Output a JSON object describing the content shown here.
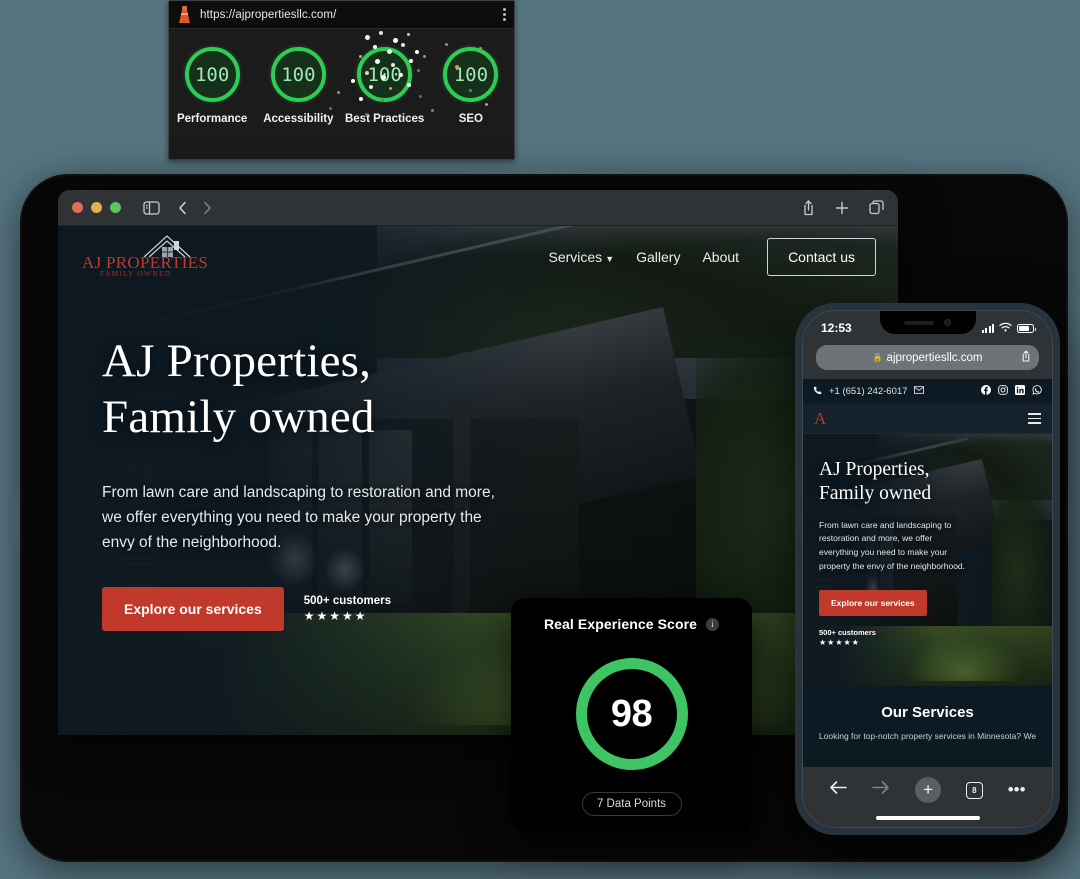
{
  "lighthouse": {
    "favicon_name": "lighthouse-icon",
    "url": "https://ajpropertiesllc.com/",
    "menu_icon": "kebab-menu-icon",
    "scores": [
      {
        "value": "100",
        "label": "Performance"
      },
      {
        "value": "100",
        "label": "Accessibility"
      },
      {
        "value": "100",
        "label": "Best Practices"
      },
      {
        "value": "100",
        "label": "SEO"
      }
    ],
    "ring_color": "#2ecc56",
    "score_text_color": "#9fe8af"
  },
  "browser": {
    "traffic_lights": [
      "close",
      "minimize",
      "zoom"
    ],
    "sidebar_icon": "sidebar-icon",
    "back_icon": "chevron-left-icon",
    "forward_icon": "chevron-right-icon",
    "share_icon": "share-icon",
    "new_tab_icon": "plus-icon",
    "tabs_icon": "tab-overview-icon"
  },
  "site": {
    "logo": {
      "line1": "AJ PROPERTIES",
      "line2": "FAMILY OWNED",
      "icon": "house-roof-icon"
    },
    "nav": [
      {
        "label": "Services",
        "has_dropdown": true
      },
      {
        "label": "Gallery",
        "has_dropdown": false
      },
      {
        "label": "About",
        "has_dropdown": false
      }
    ],
    "contact_button": "Contact us",
    "hero": {
      "title_line1": "AJ Properties,",
      "title_line2": "Family owned",
      "paragraph": "From lawn care and landscaping to restoration and more, we offer everything you need to make your property the envy of the neighborhood.",
      "cta": "Explore our services",
      "social_proof": "500+ customers",
      "stars": "★★★★★"
    },
    "accent_color": "#c0392b"
  },
  "score_card": {
    "title": "Real Experience Score",
    "info_icon": "info-icon",
    "score": "98",
    "data_points": "7 Data Points",
    "ring_color": "#3ec463"
  },
  "phone": {
    "status": {
      "time": "12:53",
      "signal_icon": "cellular-bars-icon",
      "wifi_icon": "wifi-icon",
      "battery_icon": "battery-icon"
    },
    "url": "ajpropertiesllc.com",
    "lock_icon": "lock-icon",
    "share_icon": "share-icon",
    "topbar": {
      "phone_number": "+1 (651) 242-6017",
      "phone_icon": "phone-icon",
      "mail_icon": "mail-icon",
      "socials": [
        "facebook-icon",
        "instagram-icon",
        "linkedin-icon",
        "whatsapp-icon"
      ]
    },
    "header": {
      "logo": "A",
      "menu_icon": "hamburger-menu-icon"
    },
    "hero": {
      "title_line1": "AJ Properties,",
      "title_line2": "Family owned",
      "paragraph": "From lawn care and landscaping to restoration and more, we offer everything you need to make your property the envy of the neighborhood.",
      "cta": "Explore our services",
      "social_proof": "500+ customers",
      "stars": "★★★★★"
    },
    "services": {
      "heading": "Our Services",
      "text": "Looking for top-notch property services in Minnesota? We"
    },
    "toolbar": {
      "back_icon": "arrow-left-icon",
      "forward_icon": "arrow-right-icon",
      "plus_icon": "plus-icon",
      "tab_count": "8",
      "more_icon": "ellipsis-icon"
    }
  }
}
